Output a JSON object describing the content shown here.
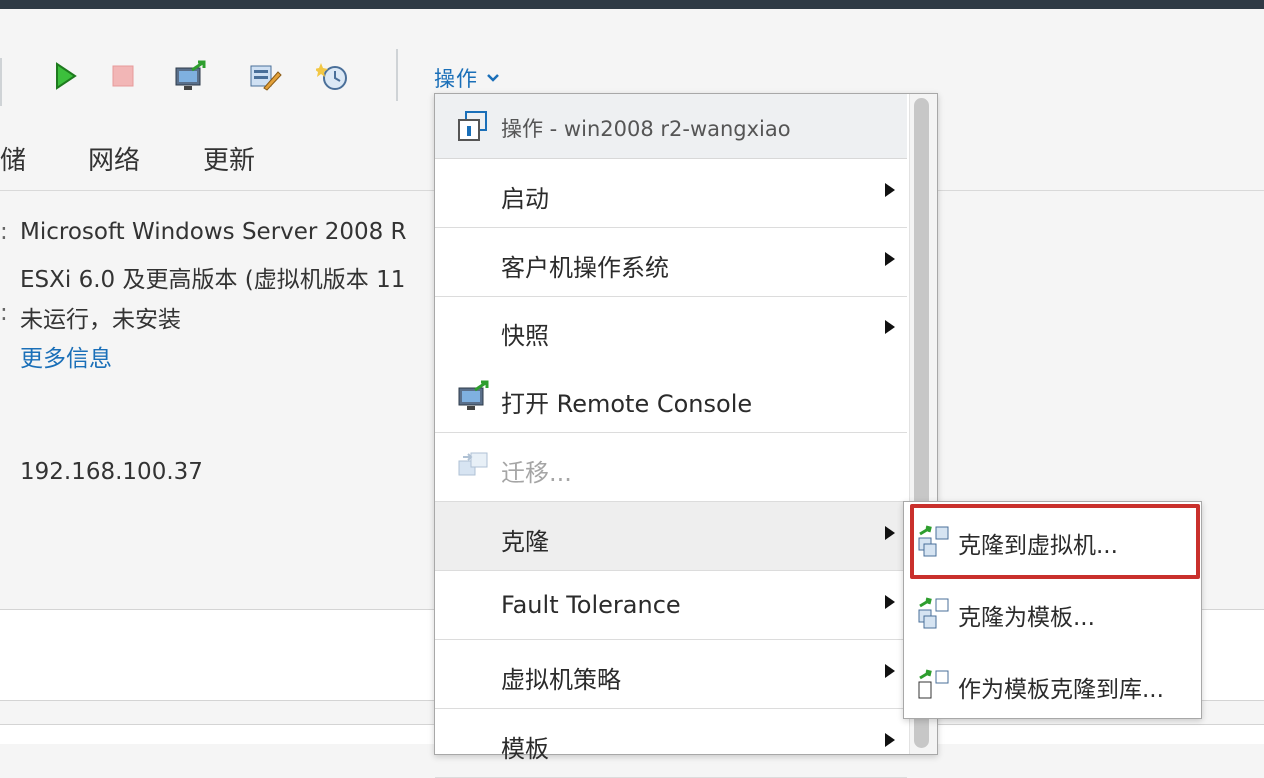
{
  "toolbar": {
    "icons": [
      "power-on-icon",
      "power-off-icon",
      "remote-console-icon",
      "edit-settings-icon",
      "snapshot-icon"
    ],
    "actions_label": "操作"
  },
  "tabs": [
    "储",
    "网络",
    "更新"
  ],
  "summary": {
    "os": "Microsoft Windows Server 2008 R",
    "compat": "ESXi 6.0 及更高版本 (虚拟机版本 11",
    "tools": "未运行，未安装",
    "more_info": "更多信息",
    "ip": "192.168.100.37"
  },
  "menu": {
    "header": "操作 - win2008 r2-wangxiao",
    "items": [
      {
        "label": "启动",
        "submenu": true
      },
      {
        "label": "客户机操作系统",
        "submenu": true
      },
      {
        "label": "快照",
        "submenu": true
      },
      {
        "label": "打开 Remote Console",
        "submenu": false,
        "icon": "remote-console-icon"
      },
      {
        "label": "迁移...",
        "submenu": false,
        "icon": "migrate-icon",
        "disabled": true
      },
      {
        "label": "克隆",
        "submenu": true,
        "hover": true
      },
      {
        "label": "Fault Tolerance",
        "submenu": true
      },
      {
        "label": "虚拟机策略",
        "submenu": true
      },
      {
        "label": "模板",
        "submenu": true
      }
    ]
  },
  "submenu": {
    "items": [
      {
        "label": "克隆到虚拟机...",
        "icon": "clone-to-vm-icon"
      },
      {
        "label": "克隆为模板...",
        "icon": "clone-to-template-icon"
      },
      {
        "label": "作为模板克隆到库...",
        "icon": "clone-to-library-icon"
      }
    ]
  },
  "colors": {
    "accent_link": "#1a6fb8",
    "highlight": "#c9302c",
    "topbar": "#2f3a45"
  }
}
